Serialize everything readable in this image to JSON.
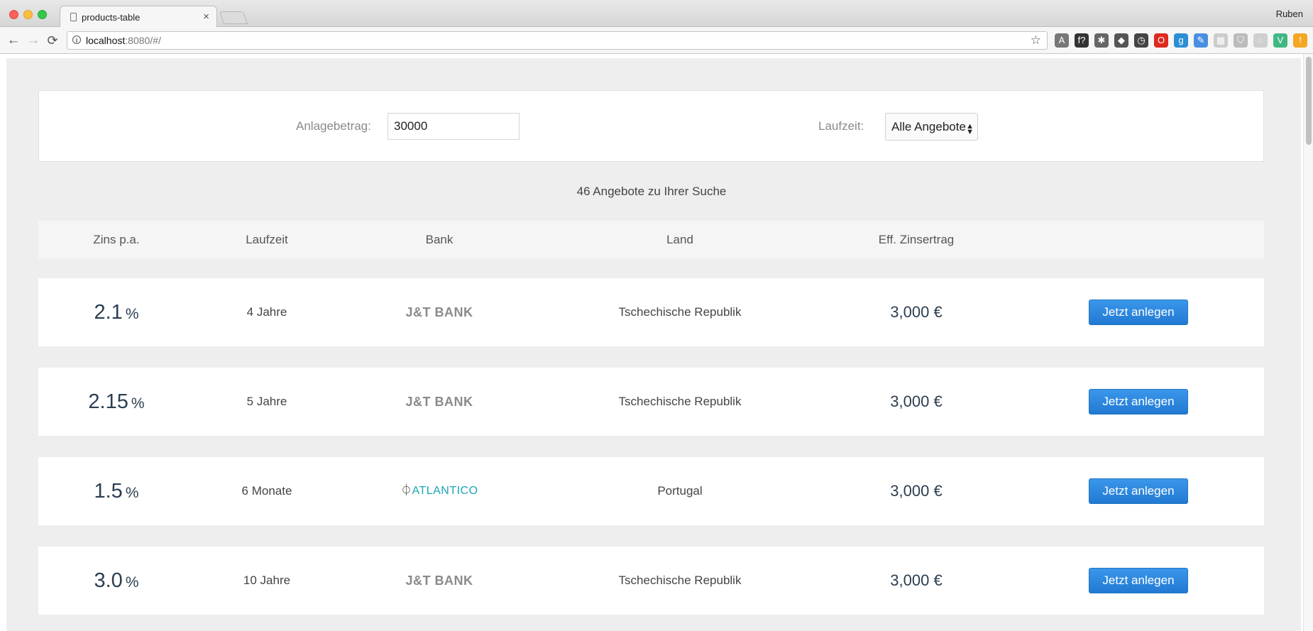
{
  "browser": {
    "tab_title": "products-table",
    "tab_close": "×",
    "profile_name": "Ruben",
    "url_host": "localhost",
    "url_rest": ":8080/#/",
    "nav": {
      "back": "←",
      "forward": "→",
      "reload": "⟳"
    },
    "star": "☆",
    "extensions": [
      {
        "name": "angular-icon",
        "color": "#777777",
        "glyph": "A"
      },
      {
        "name": "function-icon",
        "color": "#333333",
        "glyph": "f?"
      },
      {
        "name": "bug-icon",
        "color": "#666666",
        "glyph": "✱"
      },
      {
        "name": "cube-icon",
        "color": "#555555",
        "glyph": "◆"
      },
      {
        "name": "timer-icon",
        "color": "#444444",
        "glyph": "◷"
      },
      {
        "name": "opera-icon",
        "color": "#e0281e",
        "glyph": "O"
      },
      {
        "name": "ghostery-icon",
        "color": "#2b8ed6",
        "glyph": "g"
      },
      {
        "name": "eyedropper-icon",
        "color": "#4a90e2",
        "glyph": "✎"
      },
      {
        "name": "grid-icon",
        "color": "#cccccc",
        "glyph": "▦"
      },
      {
        "name": "shield-icon",
        "color": "#bbbbbb",
        "glyph": "⛉"
      },
      {
        "name": "leaf-icon",
        "color": "#cfcfcf",
        "glyph": "◌"
      },
      {
        "name": "vue-icon",
        "color": "#41b883",
        "glyph": "V"
      },
      {
        "name": "alert-icon",
        "color": "#f5a623",
        "glyph": "!"
      }
    ]
  },
  "filter": {
    "amount_label": "Anlagebetrag:",
    "amount_value": "30000",
    "term_label": "Laufzeit:",
    "term_value": "Alle Angebote"
  },
  "results_count": "46 Angebote zu Ihrer Suche",
  "table": {
    "headers": [
      "Zins p.a.",
      "Laufzeit",
      "Bank",
      "Land",
      "Eff. Zinsertrag"
    ],
    "rows": [
      {
        "rate": "2.1",
        "pct": "%",
        "term": "4 Jahre",
        "bank": "J&T BANK",
        "bank_type": "jt",
        "country": "Tschechische Republik",
        "interest": "3,000 €",
        "action": "Jetzt anlegen"
      },
      {
        "rate": "2.15",
        "pct": "%",
        "term": "5 Jahre",
        "bank": "J&T BANK",
        "bank_type": "jt",
        "country": "Tschechische Republik",
        "interest": "3,000 €",
        "action": "Jetzt anlegen"
      },
      {
        "rate": "1.5",
        "pct": "%",
        "term": "6 Monate",
        "bank": "ATLANTICO",
        "bank_type": "atlantico",
        "country": "Portugal",
        "interest": "3,000 €",
        "action": "Jetzt anlegen"
      },
      {
        "rate": "3.0",
        "pct": "%",
        "term": "10 Jahre",
        "bank": "J&T BANK",
        "bank_type": "jt",
        "country": "Tschechische Republik",
        "interest": "3,000 €",
        "action": "Jetzt anlegen"
      }
    ]
  },
  "colors": {
    "button": "#2d8be0",
    "page_bg": "#eeeeee",
    "atlantico": "#1aa6b7"
  }
}
